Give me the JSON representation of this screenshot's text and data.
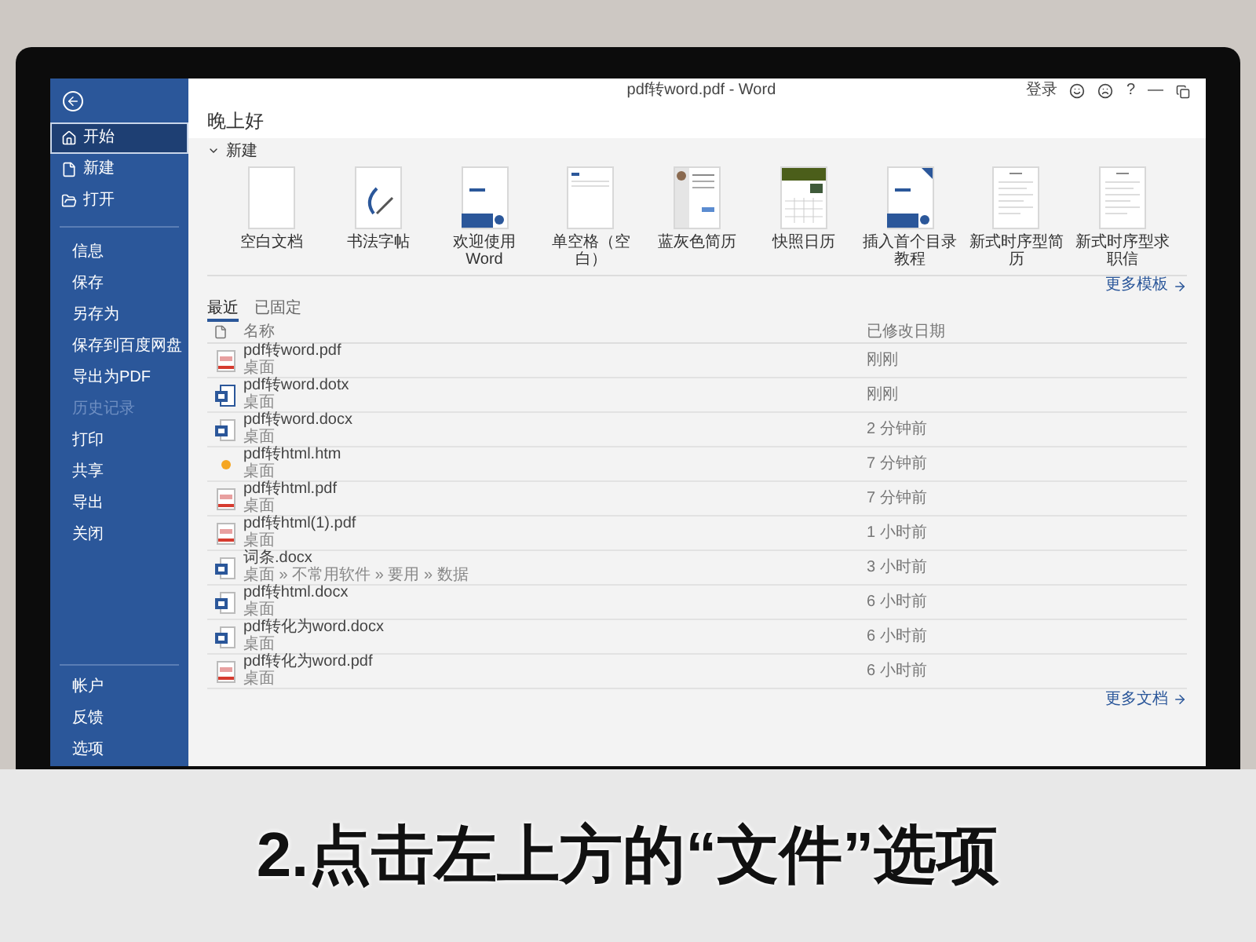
{
  "window": {
    "title": "pdf转word.pdf  -  Word",
    "sign_in": "登录",
    "help": "?",
    "minimize": "—"
  },
  "sidebar": {
    "top_items": [
      {
        "label": "开始",
        "selected": true
      },
      {
        "label": "新建",
        "selected": false
      },
      {
        "label": "打开",
        "selected": false
      }
    ],
    "middle_items": [
      {
        "label": "信息",
        "disabled": false
      },
      {
        "label": "保存",
        "disabled": false
      },
      {
        "label": "另存为",
        "disabled": false
      },
      {
        "label": "保存到百度网盘",
        "disabled": false
      },
      {
        "label": "导出为PDF",
        "disabled": false
      },
      {
        "label": "历史记录",
        "disabled": true
      },
      {
        "label": "打印",
        "disabled": false
      },
      {
        "label": "共享",
        "disabled": false
      },
      {
        "label": "导出",
        "disabled": false
      },
      {
        "label": "关闭",
        "disabled": false
      }
    ],
    "bottom_items": [
      {
        "label": "帐户"
      },
      {
        "label": "反馈"
      },
      {
        "label": "选项"
      }
    ]
  },
  "greeting": "晚上好",
  "new_section": {
    "title": "新建",
    "expanded": true,
    "templates": [
      {
        "label": "空白文档",
        "kind": "blank"
      },
      {
        "label": "书法字帖",
        "kind": "calligraphy"
      },
      {
        "label": "欢迎使用 Word",
        "kind": "welcome"
      },
      {
        "label": "单空格（空白）",
        "kind": "single"
      },
      {
        "label": "蓝灰色简历",
        "kind": "resume"
      },
      {
        "label": "快照日历",
        "kind": "calendar"
      },
      {
        "label": "插入首个目录教程",
        "kind": "toc"
      },
      {
        "label": "新式时序型简历",
        "kind": "text"
      },
      {
        "label": "新式时序型求职信",
        "kind": "text"
      }
    ],
    "more": "更多模板"
  },
  "tabs": [
    {
      "label": "最近",
      "selected": true
    },
    {
      "label": "已固定",
      "selected": false
    }
  ],
  "table": {
    "columns": [
      "名称",
      "已修改日期"
    ],
    "rows": [
      {
        "name": "pdf转word.pdf",
        "location": "桌面",
        "modified": "刚刚",
        "kind": "pdf"
      },
      {
        "name": "pdf转word.dotx",
        "location": "桌面",
        "modified": "刚刚",
        "kind": "template"
      },
      {
        "name": "pdf转word.docx",
        "location": "桌面",
        "modified": "2 分钟前",
        "kind": "word"
      },
      {
        "name": "pdf转html.htm",
        "location": "桌面",
        "modified": "7 分钟前",
        "kind": "html"
      },
      {
        "name": "pdf转html.pdf",
        "location": "桌面",
        "modified": "7 分钟前",
        "kind": "pdf"
      },
      {
        "name": "pdf转html(1).pdf",
        "location": "桌面",
        "modified": "1 小时前",
        "kind": "pdf"
      },
      {
        "name": "词条.docx",
        "location": "桌面 » 不常用软件 » 要用 » 数据",
        "modified": "3 小时前",
        "kind": "word"
      },
      {
        "name": "pdf转html.docx",
        "location": "桌面",
        "modified": "6 小时前",
        "kind": "word"
      },
      {
        "name": "pdf转化为word.docx",
        "location": "桌面",
        "modified": "6 小时前",
        "kind": "word"
      },
      {
        "name": "pdf转化为word.pdf",
        "location": "桌面",
        "modified": "6 小时前",
        "kind": "pdf"
      }
    ]
  },
  "more_documents": "更多文档",
  "caption": "2.点击左上方的“文件”选项"
}
